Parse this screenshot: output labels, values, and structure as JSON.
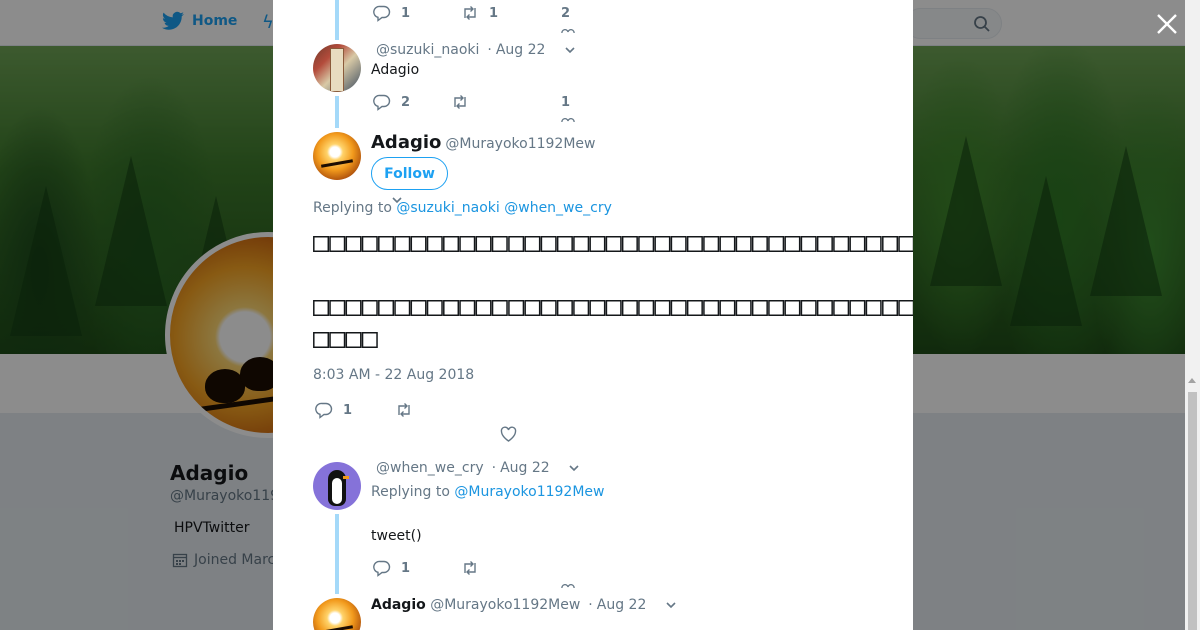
{
  "nav": {
    "home_label": "Home"
  },
  "profile": {
    "name": "Adagio",
    "handle": "@Murayoko119",
    "bio": "HPVTwitter",
    "joined": "Joined Marc"
  },
  "thread": {
    "top_partial": {
      "replies": "1",
      "retweets": "1",
      "likes": "2"
    },
    "reply1": {
      "handle": "@suzuki_naoki",
      "date": "Aug 22",
      "text": "Adagio",
      "replies": "2",
      "likes": "1"
    },
    "main": {
      "name": "Adagio",
      "handle": "@Murayoko1192Mew",
      "follow_label": "Follow",
      "replying_prefix": "Replying to",
      "replying_to_1": "@suzuki_naoki",
      "replying_to_2": "@when_we_cry",
      "paragraph1": "□□□□□□□□□□□□□□□□□□□□□□□□□□□□□□□□□□□□□□□□□□□□□□",
      "paragraph2": "□□□□□□□□□□□□□□□□□□□□□□□□□□□□□□□□□□□□□□□□□□□□□□□□□□□□□□□□□□",
      "timestamp": "8:03 AM - 22 Aug 2018",
      "replies": "1"
    },
    "reply2": {
      "handle": "@when_we_cry",
      "date": "Aug 22",
      "replying_prefix": "Replying to",
      "replying_to": "@Murayoko1192Mew",
      "text": "tweet()",
      "replies": "1"
    },
    "reply3": {
      "name": "Adagio",
      "handle": "@Murayoko1192Mew",
      "date": "Aug 22"
    }
  },
  "icons": {
    "bird": "twitter-bird-icon",
    "close": "close-icon",
    "reply": "reply-icon",
    "retweet": "retweet-icon",
    "like": "heart-icon",
    "chevron": "chevron-down-icon",
    "calendar": "calendar-icon",
    "search": "search-icon"
  },
  "colors": {
    "accent": "#1da1f2",
    "thread_line": "#a4d9f9",
    "muted": "#657786"
  }
}
